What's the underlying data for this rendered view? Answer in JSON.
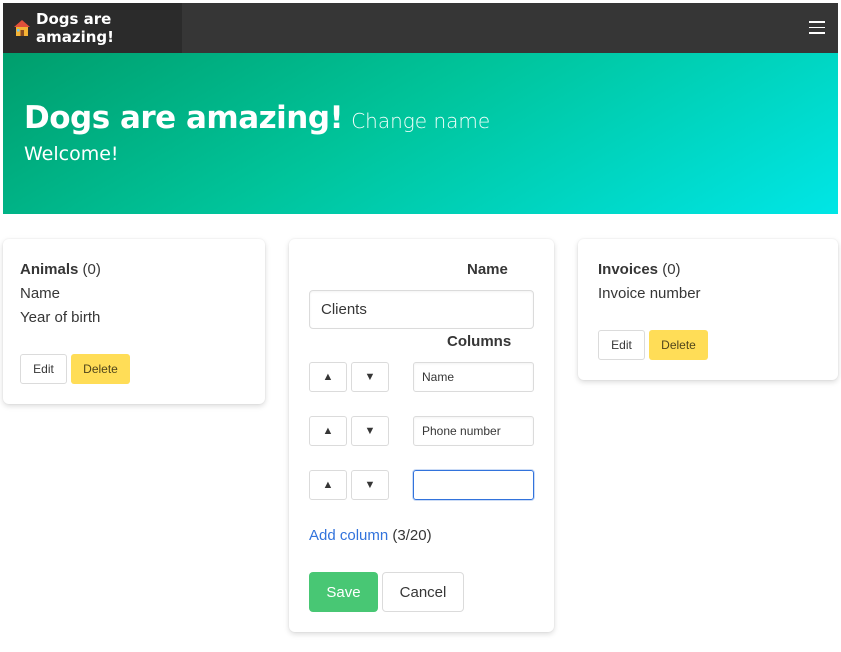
{
  "app": {
    "brand_title": "Dogs are amazing!",
    "brand_icon": "house-icon",
    "menu_icon": "hamburger-menu-icon"
  },
  "hero": {
    "title": "Dogs are amazing!",
    "change_name_link": "Change name",
    "subtitle": "Welcome!",
    "gradient_colors": [
      "#009e6c",
      "#00c49b",
      "#00e6e6"
    ]
  },
  "entities": [
    {
      "name": "Animals",
      "count": "(0)",
      "fields": [
        "Name",
        "Year of birth"
      ],
      "edit_label": "Edit",
      "delete_label": "Delete"
    },
    {
      "name": "Invoices",
      "count": "(0)",
      "fields": [
        "Invoice number"
      ],
      "edit_label": "Edit",
      "delete_label": "Delete"
    }
  ],
  "editor": {
    "name_label": "Name",
    "name_value": "Clients",
    "columns_label": "Columns",
    "up_glyph": "▲",
    "down_glyph": "▼",
    "columns": [
      "Name",
      "Phone number",
      ""
    ],
    "add_column_label": "Add column",
    "column_count": "(3/20)",
    "save_label": "Save",
    "cancel_label": "Cancel"
  },
  "colors": {
    "topbar": "#363636",
    "delete_button": "#ffdd57",
    "save_button": "#48c774",
    "link": "#3273dc"
  }
}
